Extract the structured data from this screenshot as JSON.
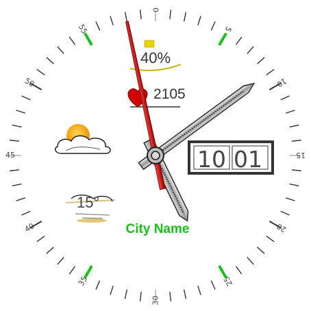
{
  "watchface": {
    "dial_numbers": [
      "0",
      "5",
      "10",
      "15",
      "20",
      "25",
      "30",
      "35",
      "40",
      "45",
      "50",
      "55"
    ],
    "battery": {
      "percent_label": "40%",
      "level": 0.4,
      "color": "#e8d400"
    },
    "steps": {
      "value": "2105"
    },
    "date_box": {
      "hour": "10",
      "minute": "01"
    },
    "weather": {
      "condition_icon": "sun-cloud-icon",
      "temperature": "15°"
    },
    "city": {
      "name": "City Name",
      "color": "#16c216"
    },
    "time": {
      "hour": 10,
      "minute": 8,
      "second": 58
    },
    "colors": {
      "accent": "#16c216",
      "second_hand": "#cc0000",
      "ticks": "#333333"
    }
  }
}
